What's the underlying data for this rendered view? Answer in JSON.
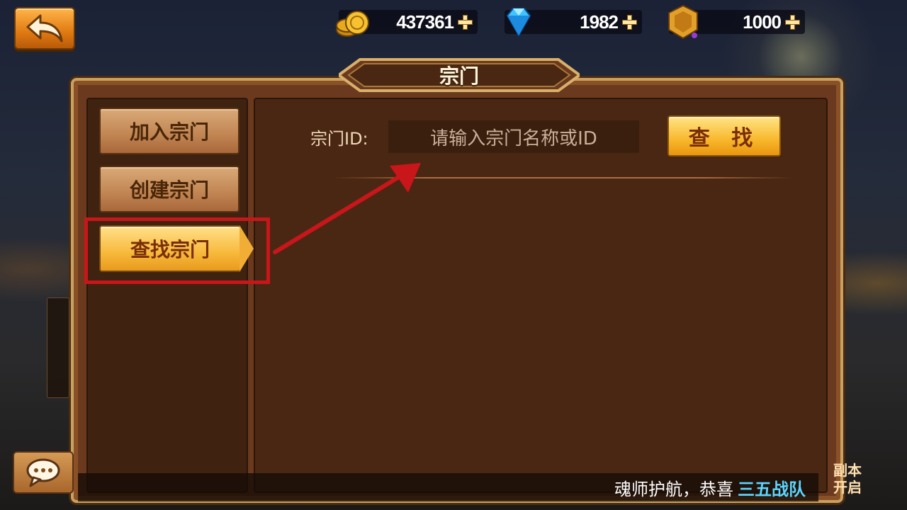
{
  "topbar": {
    "back_icon": "back-arrow-icon",
    "currencies": [
      {
        "icon": "gold-coin-icon",
        "value": "437361"
      },
      {
        "icon": "diamond-icon",
        "value": "1982"
      },
      {
        "icon": "sect-token-icon",
        "value": "1000"
      }
    ]
  },
  "panel": {
    "title": "宗门"
  },
  "tabs": [
    {
      "label": "加入宗门"
    },
    {
      "label": "创建宗门"
    },
    {
      "label": "查找宗门"
    }
  ],
  "search": {
    "label": "宗门ID:",
    "placeholder": "请输入宗门名称或ID",
    "button_label": "查 找"
  },
  "ticker": {
    "text": "魂师护航，恭喜",
    "highlight": "三五战队"
  },
  "side_right": {
    "line1": "副本",
    "line2": "开启"
  },
  "colors": {
    "highlight_box": "#c8161a",
    "active_tab": "#f7b93a",
    "ticker_highlight": "#5bd6ff"
  }
}
